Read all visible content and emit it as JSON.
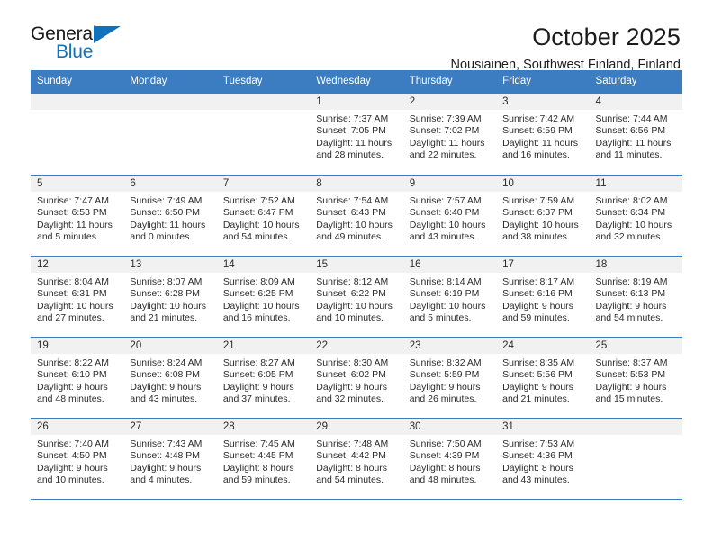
{
  "brand": {
    "name_part1": "General",
    "name_part2": "Blue",
    "triangle_color": "#1172bb"
  },
  "header": {
    "title": "October 2025",
    "subtitle": "Nousiainen, Southwest Finland, Finland",
    "header_bg_color": "#3b7dc0",
    "date_band_color": "#f1f1f1"
  },
  "weekday_headers": [
    "Sunday",
    "Monday",
    "Tuesday",
    "Wednesday",
    "Thursday",
    "Friday",
    "Saturday"
  ],
  "labels": {
    "sunrise_prefix": "Sunrise:",
    "sunset_prefix": "Sunset:",
    "daylight_prefix": "Daylight:"
  },
  "weeks": [
    [
      {
        "date": "",
        "empty": true
      },
      {
        "date": "",
        "empty": true
      },
      {
        "date": "",
        "empty": true
      },
      {
        "date": "1",
        "sunrise": "Sunrise: 7:37 AM",
        "sunset": "Sunset: 7:05 PM",
        "daylight": "Daylight: 11 hours and 28 minutes."
      },
      {
        "date": "2",
        "sunrise": "Sunrise: 7:39 AM",
        "sunset": "Sunset: 7:02 PM",
        "daylight": "Daylight: 11 hours and 22 minutes."
      },
      {
        "date": "3",
        "sunrise": "Sunrise: 7:42 AM",
        "sunset": "Sunset: 6:59 PM",
        "daylight": "Daylight: 11 hours and 16 minutes."
      },
      {
        "date": "4",
        "sunrise": "Sunrise: 7:44 AM",
        "sunset": "Sunset: 6:56 PM",
        "daylight": "Daylight: 11 hours and 11 minutes."
      }
    ],
    [
      {
        "date": "5",
        "sunrise": "Sunrise: 7:47 AM",
        "sunset": "Sunset: 6:53 PM",
        "daylight": "Daylight: 11 hours and 5 minutes."
      },
      {
        "date": "6",
        "sunrise": "Sunrise: 7:49 AM",
        "sunset": "Sunset: 6:50 PM",
        "daylight": "Daylight: 11 hours and 0 minutes."
      },
      {
        "date": "7",
        "sunrise": "Sunrise: 7:52 AM",
        "sunset": "Sunset: 6:47 PM",
        "daylight": "Daylight: 10 hours and 54 minutes."
      },
      {
        "date": "8",
        "sunrise": "Sunrise: 7:54 AM",
        "sunset": "Sunset: 6:43 PM",
        "daylight": "Daylight: 10 hours and 49 minutes."
      },
      {
        "date": "9",
        "sunrise": "Sunrise: 7:57 AM",
        "sunset": "Sunset: 6:40 PM",
        "daylight": "Daylight: 10 hours and 43 minutes."
      },
      {
        "date": "10",
        "sunrise": "Sunrise: 7:59 AM",
        "sunset": "Sunset: 6:37 PM",
        "daylight": "Daylight: 10 hours and 38 minutes."
      },
      {
        "date": "11",
        "sunrise": "Sunrise: 8:02 AM",
        "sunset": "Sunset: 6:34 PM",
        "daylight": "Daylight: 10 hours and 32 minutes."
      }
    ],
    [
      {
        "date": "12",
        "sunrise": "Sunrise: 8:04 AM",
        "sunset": "Sunset: 6:31 PM",
        "daylight": "Daylight: 10 hours and 27 minutes."
      },
      {
        "date": "13",
        "sunrise": "Sunrise: 8:07 AM",
        "sunset": "Sunset: 6:28 PM",
        "daylight": "Daylight: 10 hours and 21 minutes."
      },
      {
        "date": "14",
        "sunrise": "Sunrise: 8:09 AM",
        "sunset": "Sunset: 6:25 PM",
        "daylight": "Daylight: 10 hours and 16 minutes."
      },
      {
        "date": "15",
        "sunrise": "Sunrise: 8:12 AM",
        "sunset": "Sunset: 6:22 PM",
        "daylight": "Daylight: 10 hours and 10 minutes."
      },
      {
        "date": "16",
        "sunrise": "Sunrise: 8:14 AM",
        "sunset": "Sunset: 6:19 PM",
        "daylight": "Daylight: 10 hours and 5 minutes."
      },
      {
        "date": "17",
        "sunrise": "Sunrise: 8:17 AM",
        "sunset": "Sunset: 6:16 PM",
        "daylight": "Daylight: 9 hours and 59 minutes."
      },
      {
        "date": "18",
        "sunrise": "Sunrise: 8:19 AM",
        "sunset": "Sunset: 6:13 PM",
        "daylight": "Daylight: 9 hours and 54 minutes."
      }
    ],
    [
      {
        "date": "19",
        "sunrise": "Sunrise: 8:22 AM",
        "sunset": "Sunset: 6:10 PM",
        "daylight": "Daylight: 9 hours and 48 minutes."
      },
      {
        "date": "20",
        "sunrise": "Sunrise: 8:24 AM",
        "sunset": "Sunset: 6:08 PM",
        "daylight": "Daylight: 9 hours and 43 minutes."
      },
      {
        "date": "21",
        "sunrise": "Sunrise: 8:27 AM",
        "sunset": "Sunset: 6:05 PM",
        "daylight": "Daylight: 9 hours and 37 minutes."
      },
      {
        "date": "22",
        "sunrise": "Sunrise: 8:30 AM",
        "sunset": "Sunset: 6:02 PM",
        "daylight": "Daylight: 9 hours and 32 minutes."
      },
      {
        "date": "23",
        "sunrise": "Sunrise: 8:32 AM",
        "sunset": "Sunset: 5:59 PM",
        "daylight": "Daylight: 9 hours and 26 minutes."
      },
      {
        "date": "24",
        "sunrise": "Sunrise: 8:35 AM",
        "sunset": "Sunset: 5:56 PM",
        "daylight": "Daylight: 9 hours and 21 minutes."
      },
      {
        "date": "25",
        "sunrise": "Sunrise: 8:37 AM",
        "sunset": "Sunset: 5:53 PM",
        "daylight": "Daylight: 9 hours and 15 minutes."
      }
    ],
    [
      {
        "date": "26",
        "sunrise": "Sunrise: 7:40 AM",
        "sunset": "Sunset: 4:50 PM",
        "daylight": "Daylight: 9 hours and 10 minutes."
      },
      {
        "date": "27",
        "sunrise": "Sunrise: 7:43 AM",
        "sunset": "Sunset: 4:48 PM",
        "daylight": "Daylight: 9 hours and 4 minutes."
      },
      {
        "date": "28",
        "sunrise": "Sunrise: 7:45 AM",
        "sunset": "Sunset: 4:45 PM",
        "daylight": "Daylight: 8 hours and 59 minutes."
      },
      {
        "date": "29",
        "sunrise": "Sunrise: 7:48 AM",
        "sunset": "Sunset: 4:42 PM",
        "daylight": "Daylight: 8 hours and 54 minutes."
      },
      {
        "date": "30",
        "sunrise": "Sunrise: 7:50 AM",
        "sunset": "Sunset: 4:39 PM",
        "daylight": "Daylight: 8 hours and 48 minutes."
      },
      {
        "date": "31",
        "sunrise": "Sunrise: 7:53 AM",
        "sunset": "Sunset: 4:36 PM",
        "daylight": "Daylight: 8 hours and 43 minutes."
      },
      {
        "date": "",
        "empty": true
      }
    ]
  ]
}
